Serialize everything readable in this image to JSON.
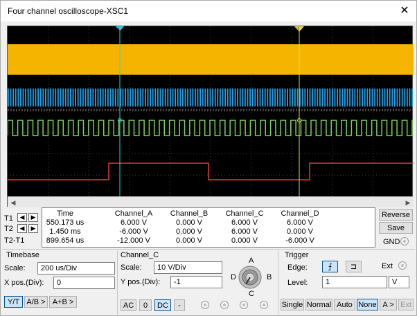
{
  "window": {
    "title": "Four channel oscilloscope-XSC1",
    "close_glyph": "✕"
  },
  "cursors": {
    "t1_marker": "1",
    "t2_marker": "2"
  },
  "readout": {
    "headers": [
      "Time",
      "Channel_A",
      "Channel_B",
      "Channel_C",
      "Channel_D"
    ],
    "rows": [
      {
        "label": "T1",
        "time": "550.173 us",
        "a": "6.000 V",
        "b": "0.000 V",
        "c": "6.000 V",
        "d": "6.000 V"
      },
      {
        "label": "T2",
        "time": "1.450 ms",
        "a": "-6.000 V",
        "b": "0.000 V",
        "c": "6.000 V",
        "d": "0.000 V"
      },
      {
        "label": "T2-T1",
        "time": "899.654 us",
        "a": "-12.000 V",
        "b": "0.000 V",
        "c": "0.000 V",
        "d": "-6.000 V"
      }
    ]
  },
  "side": {
    "reverse": "Reverse",
    "save": "Save",
    "gnd": "GND"
  },
  "timebase": {
    "title": "Timebase",
    "scale_label": "Scale:",
    "scale_value": "200 us/Div",
    "xpos_label": "X pos.(Div):",
    "xpos_value": "0",
    "yt": "Y/T",
    "ab": "A/B >",
    "aplusb": "A+B >"
  },
  "channel": {
    "title": "Channel_C",
    "scale_label": "Scale:",
    "scale_value": "10  V/Div",
    "ypos_label": "Y pos.(Div):",
    "ypos_value": "-1",
    "ac": "AC",
    "zero": "0",
    "dc": "DC",
    "minus": "-",
    "knob": {
      "a": "A",
      "b": "B",
      "c": "C",
      "d": "D"
    }
  },
  "trigger": {
    "title": "Trigger",
    "edge_label": "Edge:",
    "ext_label": "Ext",
    "level_label": "Level:",
    "level_value": "1",
    "level_unit": "V",
    "single": "Single",
    "normal": "Normal",
    "auto": "Auto",
    "none": "None",
    "a_sel": "A >",
    "ext_btn": "Ext"
  },
  "colors": {
    "channel_a": "#f5b400",
    "channel_b": "#1ea0e6",
    "channel_c": "#7ad45a",
    "channel_d": "#e23a3a",
    "cursor1": "#2ad0e0",
    "cursor2": "#e6d84a"
  }
}
